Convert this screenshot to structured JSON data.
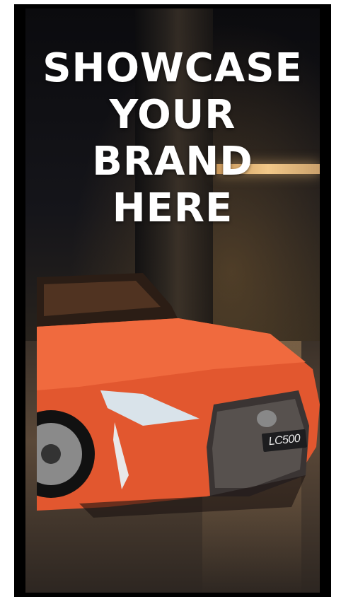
{
  "banner": {
    "headline_lines": [
      "SHOWCASE",
      "YOUR",
      "BRAND",
      "HERE"
    ],
    "plate_text": "LC500"
  },
  "colors": {
    "background": "#000000",
    "text": "#ffffff",
    "car": "#e2572f"
  }
}
